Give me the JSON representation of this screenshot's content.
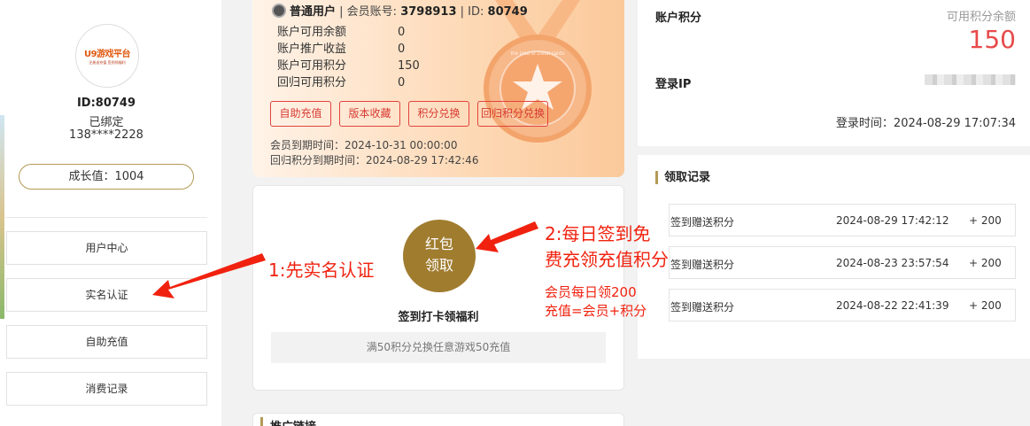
{
  "sidebar": {
    "avatar_logo": "U9游戏平台",
    "avatar_sub": "注册送充值 签到领福利",
    "user_id": "ID:80749",
    "bind_status": "已绑定",
    "phone": "138****2228",
    "growth": "成长值：1004",
    "menu": [
      {
        "label": "用户中心"
      },
      {
        "label": "实名认证"
      },
      {
        "label": "自助充值"
      },
      {
        "label": "消费记录"
      }
    ]
  },
  "vip_card": {
    "user_type": "普通用户",
    "sep1": " | 会员账号: ",
    "account_no": "3798913",
    "sep2": " | ID: ",
    "id": "80749",
    "stats": [
      {
        "label": "账户可用余额",
        "value": "0"
      },
      {
        "label": "账户推广收益",
        "value": "0"
      },
      {
        "label": "账户可用积分",
        "value": "150"
      },
      {
        "label": "回归可用积分",
        "value": "0"
      }
    ],
    "buttons": [
      "自助充值",
      "版本收藏",
      "积分兑换",
      "回归积分兑换"
    ],
    "member_expire": "会员到期时间：2024-10-31 00:00:00",
    "return_expire": "回归积分到期时间：2024-08-29 17:42:46",
    "medal_text": "the God of credit cards"
  },
  "sign_card": {
    "redpack_line1": "红包",
    "redpack_line2": "领取",
    "title": "签到打卡领福利",
    "note": "满50积分兑换任意游戏50充值"
  },
  "promo": {
    "title": "推广链接"
  },
  "account": {
    "points_label": "账户积分",
    "points_sub": "可用积分余额",
    "points": "150",
    "ip_label": "登录IP",
    "login_time": "登录时间：2024-08-29 17:07:34"
  },
  "records": {
    "title": "领取记录",
    "rows": [
      {
        "type": "签到赠送积分",
        "time": "2024-08-29 17:42:12",
        "amount": "+ 200"
      },
      {
        "type": "签到赠送积分",
        "time": "2024-08-23 23:57:54",
        "amount": "+ 200"
      },
      {
        "type": "签到赠送积分",
        "time": "2024-08-22 22:41:39",
        "amount": "+ 200"
      }
    ]
  },
  "annotations": {
    "step1": "1:先实名认证",
    "step2_line1": "2:每日签到免",
    "step2_line2": "费充领充值积分",
    "note_line1": "会员每日领200",
    "note_line2": "充值=会员+积分"
  },
  "colors": {
    "accent_gold": "#b49a57",
    "redpack": "#a07c2f",
    "points_red": "#e84a4a",
    "annotation_red": "#f0220f"
  }
}
